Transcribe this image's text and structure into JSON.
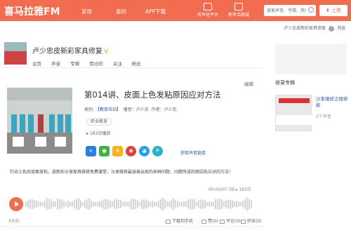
{
  "header": {
    "logo": "喜马拉雅FM",
    "nav": [
      "发现",
      "我的",
      "APP下载"
    ],
    "icon_links": [
      "有声化平台",
      "新声活商城"
    ],
    "search_placeholder": "搜索声音、专辑、用户",
    "upload_label": "上传"
  },
  "user": {
    "name": "卢少忠皮新彩家具修复",
    "message_label": "消息"
  },
  "profile": {
    "name": "卢少忠皮新彩家具修复",
    "tabs": [
      "主页",
      "声音",
      "专辑",
      "赞过的",
      "关注",
      "粉丝"
    ]
  },
  "episode": {
    "edit_label": "编辑",
    "title": "第014讲、皮面上色发粘原因应对方法",
    "category_label": "类别:",
    "category_value": "【教育培训】",
    "host_label": "播音：卢少忠",
    "author_label": "作者：卢少忠",
    "tag": "职业教育",
    "plays": "183次播放",
    "share_label": "获取声音链接",
    "description": "针对上色后皮面发粘，皮新彩沙发家具维修免费课堂，沙发维修最容易出现的各种问题，问题所成的原因及应对的方法！"
  },
  "player": {
    "time": "00:00/07:38",
    "play_count": "183次"
  },
  "footer": {
    "left": "4天前",
    "actions": [
      "下载到手机",
      "赞(0)",
      "评论(0)",
      "转采(0)"
    ]
  },
  "sidebar": {
    "title": "收录专辑",
    "album_title": "沙发维修之碰修新",
    "album_count": "2个声音"
  },
  "colors": {
    "brand": "#f26c4f",
    "link": "#2a5caa"
  },
  "icons": [
    "plus-icon",
    "wechat-icon",
    "qzone-icon",
    "weibo-icon",
    "qq-icon",
    "link-icon"
  ]
}
